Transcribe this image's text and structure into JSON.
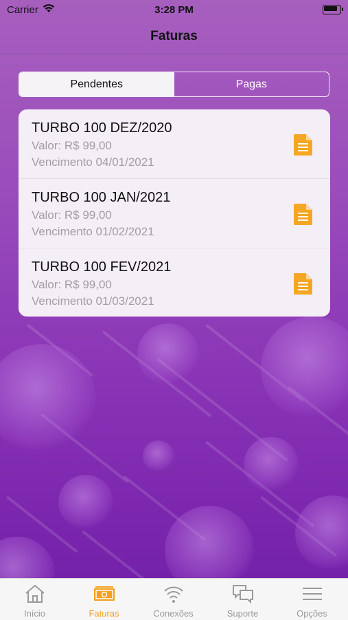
{
  "status_bar": {
    "carrier": "Carrier",
    "time": "3:28 PM"
  },
  "header": {
    "title": "Faturas"
  },
  "segments": [
    {
      "label": "Pendentes",
      "selected": true
    },
    {
      "label": "Pagas",
      "selected": false
    }
  ],
  "invoices": [
    {
      "title": "TURBO 100 DEZ/2020",
      "value": "Valor: R$ 99,00",
      "due": "Vencimento 04/01/2021"
    },
    {
      "title": "TURBO 100 JAN/2021",
      "value": "Valor: R$ 99,00",
      "due": "Vencimento 01/02/2021"
    },
    {
      "title": "TURBO 100 FEV/2021",
      "value": "Valor: R$ 99,00",
      "due": "Vencimento 01/03/2021"
    }
  ],
  "tabbar": {
    "items": [
      {
        "label": "Início",
        "icon": "home-icon"
      },
      {
        "label": "Faturas",
        "icon": "money-icon",
        "active": true
      },
      {
        "label": "Conexões",
        "icon": "wifi-icon"
      },
      {
        "label": "Suporte",
        "icon": "chat-icon"
      },
      {
        "label": "Opções",
        "icon": "menu-icon"
      }
    ]
  },
  "colors": {
    "accent": "#f4a020",
    "doc_icon": "#f5a623",
    "background": "#8a35b6"
  }
}
